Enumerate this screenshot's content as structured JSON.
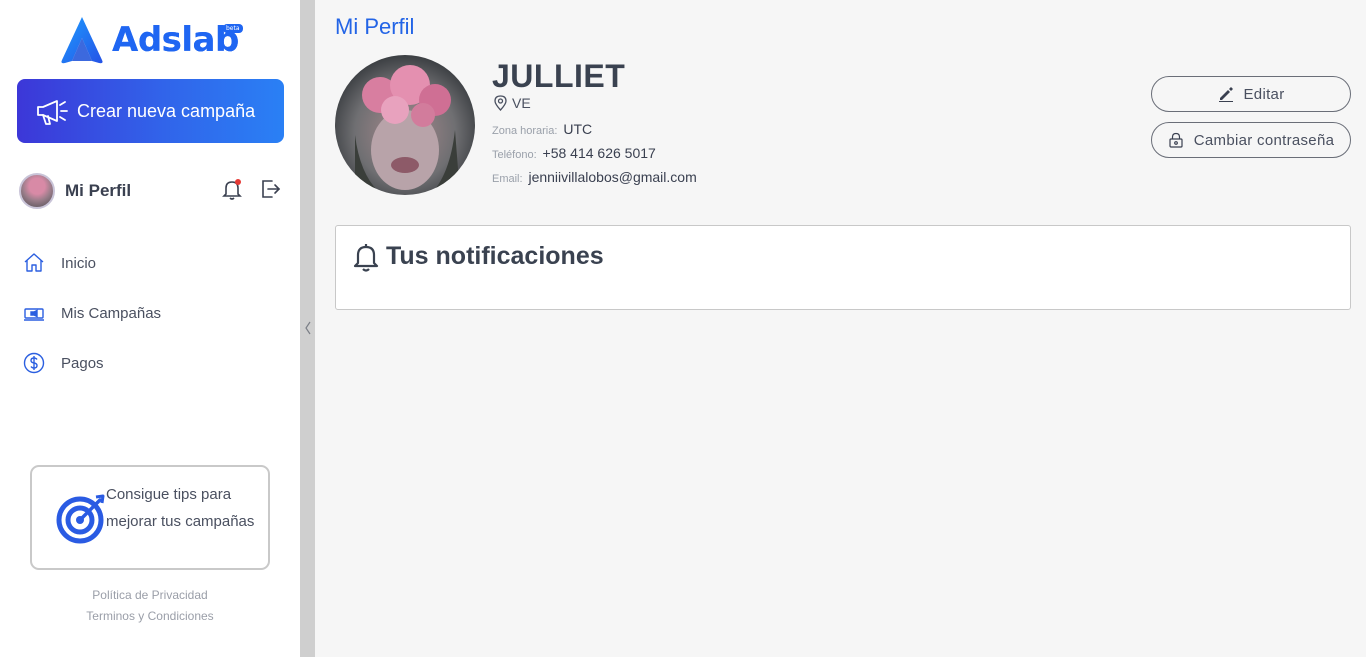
{
  "brand": {
    "name": "Adslab",
    "badge": "beta"
  },
  "sidebar": {
    "cta_label": "Crear nueva campaña",
    "profile_label": "Mi Perfil",
    "nav": [
      {
        "label": "Inicio",
        "icon": "home-icon"
      },
      {
        "label": "Mis Campañas",
        "icon": "campaign-monitor-icon"
      },
      {
        "label": "Pagos",
        "icon": "dollar-icon"
      }
    ],
    "tips": "Consigue tips para mejorar tus campañas",
    "footer": {
      "privacy": "Política de Privacidad",
      "terms": "Terminos y Condiciones"
    }
  },
  "main": {
    "title": "Mi Perfil",
    "user": {
      "name": "JULLIET",
      "location": "VE",
      "timezone_label": "Zona horaria:",
      "timezone": "UTC",
      "phone_label": "Teléfono:",
      "phone": "+58 414 626 5017",
      "email_label": "Email:",
      "email": "jenniivillalobos@gmail.com"
    },
    "actions": {
      "edit": "Editar",
      "change_password": "Cambiar contraseña"
    },
    "notifications_title": "Tus notificaciones"
  },
  "colors": {
    "accent": "#2364e6",
    "cta_gradient_start": "#3c37d8",
    "cta_gradient_end": "#2a80f5",
    "notification_dot": "#e53935"
  }
}
